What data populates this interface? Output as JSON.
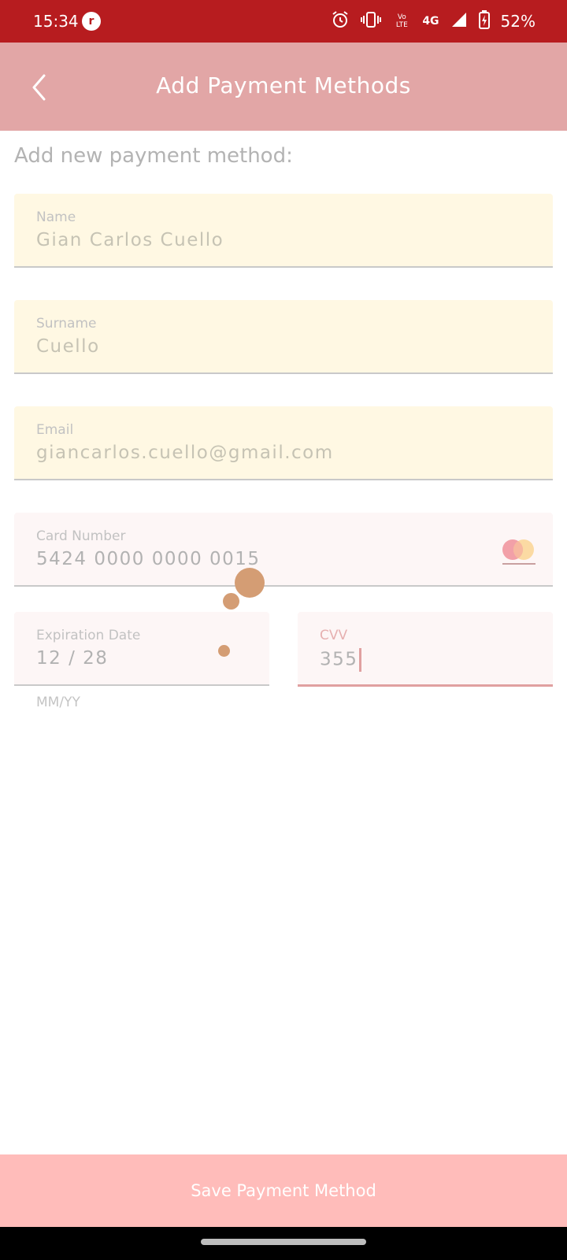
{
  "status_bar": {
    "time": "15:34",
    "app_icon_letter": "r",
    "network_label": "4G",
    "volte_label": "Vo LTE",
    "battery_percent": "52%"
  },
  "app_bar": {
    "title": "Add Payment Methods"
  },
  "section_label": "Add new payment method:",
  "form": {
    "name": {
      "label": "Name",
      "value": "Gian Carlos Cuello"
    },
    "surname": {
      "label": "Surname",
      "value": "Cuello"
    },
    "email": {
      "label": "Email",
      "value": "giancarlos.cuello@gmail.com"
    },
    "card_number": {
      "label": "Card Number",
      "value": "5424 0000 0000 0015",
      "brand_icon": "mastercard-icon"
    },
    "expiration": {
      "label": "Expiration Date",
      "value": "12 / 28",
      "helper": "MM/YY"
    },
    "cvv": {
      "label": "CVV",
      "value": "355"
    }
  },
  "save_button": {
    "label": "Save Payment Method"
  },
  "colors": {
    "status_bar": "#b71c1f",
    "app_bar": "#e2a6a6",
    "field_yellow": "#fff8e3",
    "field_pink": "#fdf6f6",
    "save_button": "#ffbcba",
    "accent": "#e0a0a0"
  }
}
